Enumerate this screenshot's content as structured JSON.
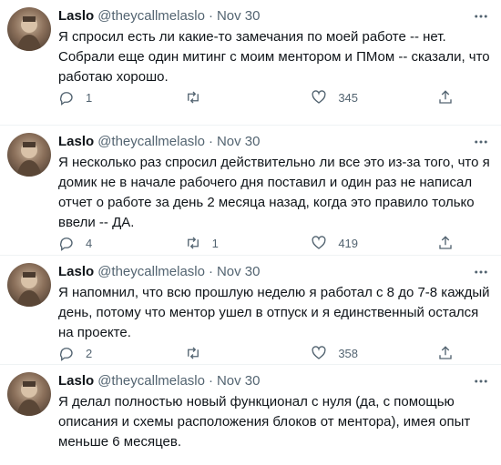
{
  "colors": {
    "text": "#0f1419",
    "secondary": "#536471",
    "divider": "#eff3f4"
  },
  "icons": [
    "more-icon",
    "reply-icon",
    "retweet-icon",
    "like-icon",
    "share-icon"
  ],
  "tweets": [
    {
      "name": "Laslo",
      "handle": "@theycallmelaslo",
      "sep": "·",
      "time": "Nov 30",
      "text": "Я спросил есть ли какие-то замечания по моей работе -- нет. Собрали еще один митинг с моим ментором и ПМом -- сказали, что работаю хорошо.",
      "replies": "1",
      "retweets": "",
      "likes": "345"
    },
    {
      "name": "Laslo",
      "handle": "@theycallmelaslo",
      "sep": "·",
      "time": "Nov 30",
      "text": "Я несколько раз спросил действительно ли все это из-за того, что я домик не в начале рабочего дня поставил и один раз не написал отчет о работе за день 2 месяца назад, когда это правило только ввели -- ДА.",
      "replies": "4",
      "retweets": "1",
      "likes": "419"
    },
    {
      "name": "Laslo",
      "handle": "@theycallmelaslo",
      "sep": "·",
      "time": "Nov 30",
      "text": "Я напомнил, что всю прошлую неделю я работал с 8 до 7-8 каждый день, потому что ментор ушел в отпуск и я единственный остался на проекте.",
      "replies": "2",
      "retweets": "",
      "likes": "358"
    },
    {
      "name": "Laslo",
      "handle": "@theycallmelaslo",
      "sep": "·",
      "time": "Nov 30",
      "text": "Я делал полностью новый функционал с нуля (да, с помощью описания и схемы расположения блоков от ментора), имея опыт меньше 6 месяцев."
    }
  ]
}
